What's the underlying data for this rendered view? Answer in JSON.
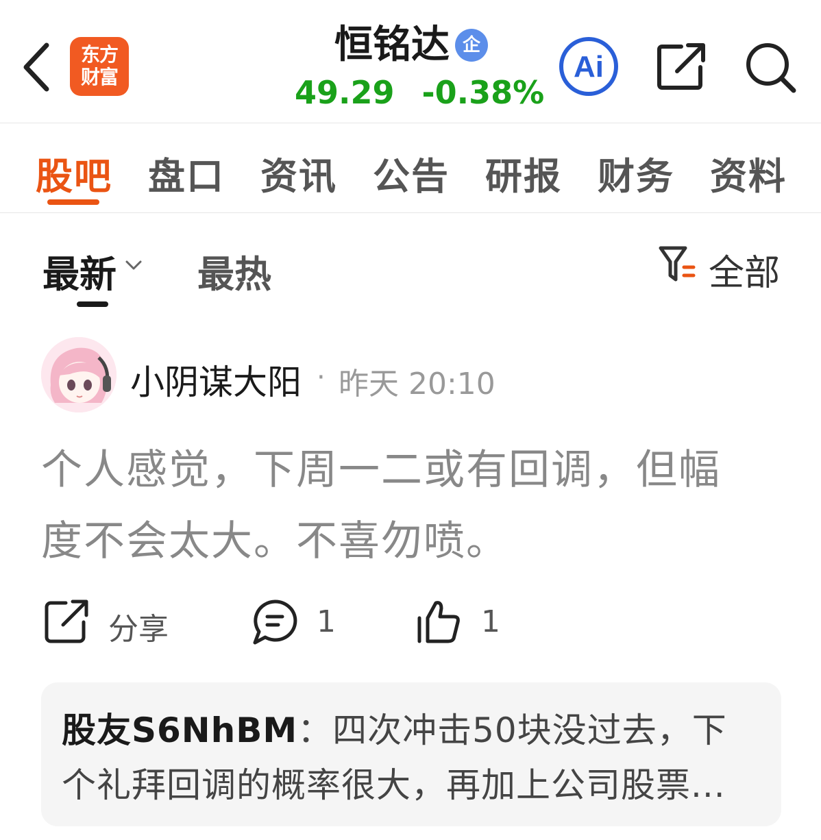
{
  "header": {
    "logo_line1": "东方",
    "logo_line2": "财富",
    "stock_name": "恒铭达",
    "badge": "企",
    "price": "49.29",
    "change": "-0.38%",
    "ai_label": "Ai",
    "price_color": "#1aa11a",
    "accent_color": "#ea5413"
  },
  "tabs": [
    {
      "label": "股吧",
      "active": true
    },
    {
      "label": "盘口"
    },
    {
      "label": "资讯"
    },
    {
      "label": "公告"
    },
    {
      "label": "研报"
    },
    {
      "label": "财务"
    },
    {
      "label": "资料"
    }
  ],
  "sort": {
    "latest": "最新",
    "hot": "最热",
    "filter": "全部"
  },
  "post": {
    "author": "小阴谋大阳",
    "dot": "·",
    "time": "昨天 20:10",
    "line1": "个人感觉，下周一二或有回调，但幅",
    "line2": "度不会太大。不喜勿喷。",
    "share_label": "分享",
    "comment_count": "1",
    "like_count": "1"
  },
  "reply": {
    "user": "股友S6NhBM",
    "sep": "：",
    "line1": "四次冲击50块没过去，下",
    "line2": "个礼拜回调的概率很大，再加上公司股票..."
  }
}
